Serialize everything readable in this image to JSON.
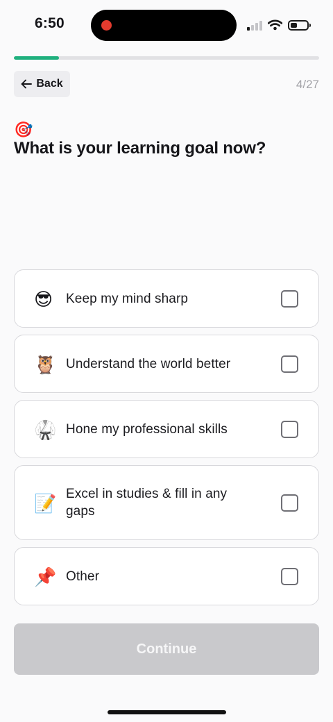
{
  "status_bar": {
    "time": "6:50"
  },
  "progress": {
    "fraction": 0.148
  },
  "header": {
    "back_label": "Back",
    "step_counter": "4/27"
  },
  "question": {
    "emoji": "🎯",
    "title": "What is your learning goal now?"
  },
  "options": [
    {
      "emoji": "😎",
      "label": "Keep my mind sharp",
      "checked": false
    },
    {
      "emoji": "🦉",
      "label": "Understand the world better",
      "checked": false
    },
    {
      "emoji": "🥋",
      "label": "Hone my professional skills",
      "checked": false
    },
    {
      "emoji": "📝",
      "label": "Excel in studies & fill in any gaps",
      "checked": false
    },
    {
      "emoji": "📌",
      "label": "Other",
      "checked": false
    }
  ],
  "footer": {
    "continue_label": "Continue",
    "continue_enabled": false
  },
  "colors": {
    "accent": "#1fb07e",
    "disabled_button": "#c9c9cc"
  }
}
